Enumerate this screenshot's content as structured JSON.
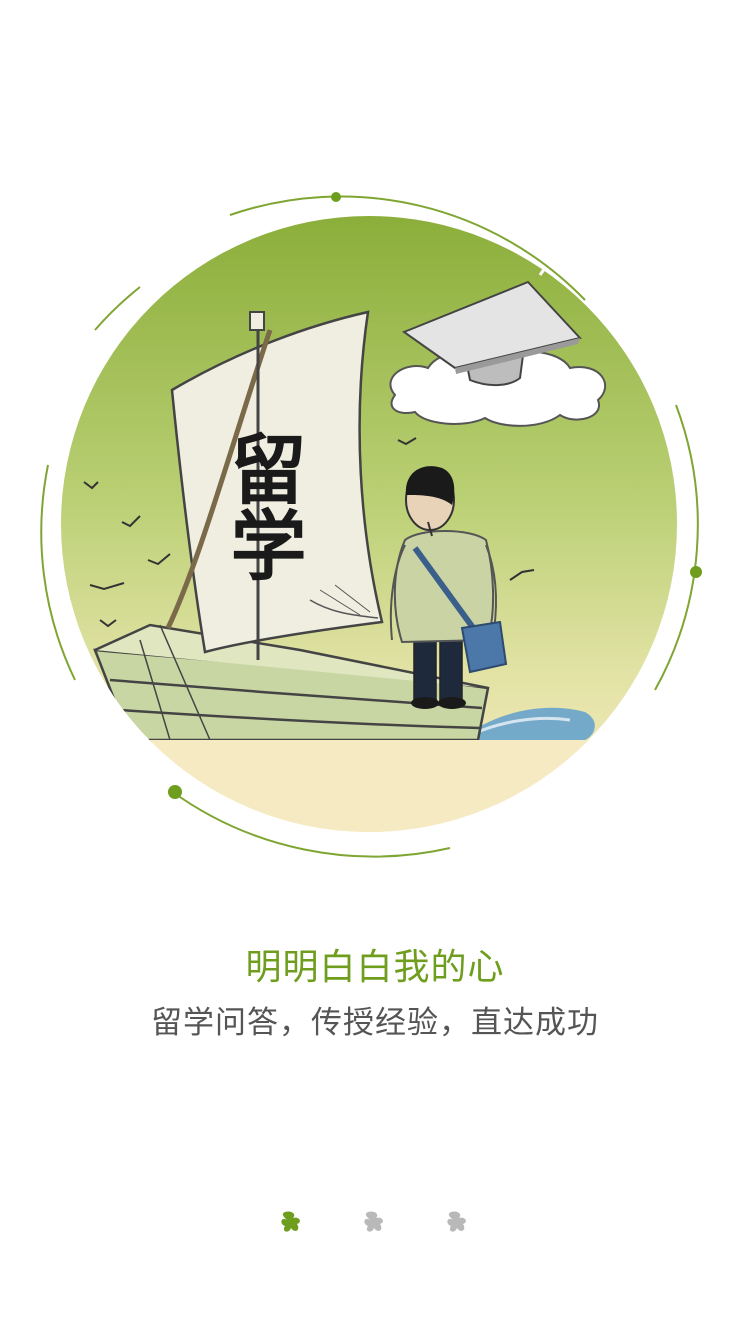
{
  "onboarding": {
    "sail_text": "留学",
    "title": "明明白白我的心",
    "subtitle": "留学问答，传授经验，直达成功",
    "pages": [
      {
        "active": true
      },
      {
        "active": false
      },
      {
        "active": false
      }
    ]
  },
  "colors": {
    "accent": "#6f9e1f",
    "inactive_dot": "#b9b9b9",
    "circle_top": "#8cb03c",
    "circle_bottom": "#f7eac3",
    "subtitle": "#555555"
  },
  "icons": {
    "hero": "study-abroad-sailboat-illustration",
    "pager": "leaf-dot-icon"
  }
}
